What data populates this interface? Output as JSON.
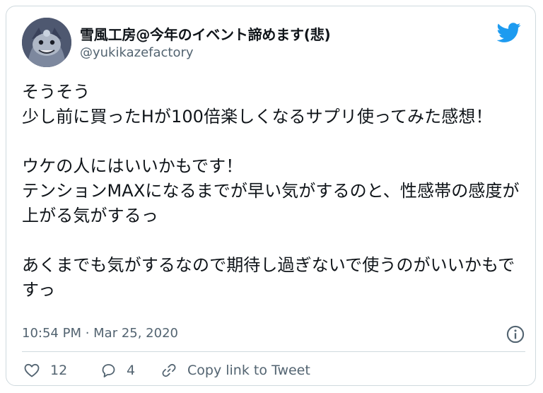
{
  "tweet": {
    "display_name": "雪風工房@今年のイベント諦めます(悲)",
    "handle": "@yukikazefactory",
    "text": "そうそう\n少し前に買ったHが100倍楽しくなるサプリ使ってみた感想！\n\nウケの人にはいいかもです！\nテンションMAXになるまでが早い気がするのと、性感帯の感度が上がる気がするっ\n\nあくまでも気がするなので期待し過ぎないで使うのがいいかもですっ",
    "timestamp": "10:54 PM · Mar 25, 2020"
  },
  "actions": {
    "like_count": "12",
    "reply_count": "4",
    "copy_link_label": "Copy link to Tweet"
  },
  "icons": {
    "brand": "twitter-bird-icon",
    "info": "info-icon",
    "like": "heart-icon",
    "reply": "reply-bubble-icon",
    "link": "link-icon"
  },
  "colors": {
    "twitter_blue": "#1d9bf0",
    "secondary_text": "#536471",
    "border": "#cfd9de"
  }
}
